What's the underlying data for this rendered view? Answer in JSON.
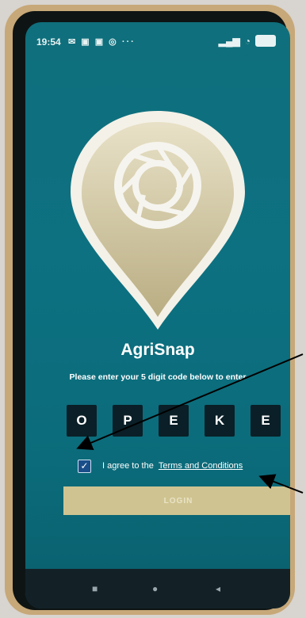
{
  "status_bar": {
    "time": "19:54",
    "left_icons": [
      "message-icon",
      "image-icon",
      "image-icon",
      "chat-icon",
      "more-icon"
    ],
    "right_icons": [
      "signal-icon",
      "wifi-icon",
      "battery-icon"
    ]
  },
  "app": {
    "name": "AgriSnap",
    "subtitle": "Please enter your 5 digit code below to enter",
    "code": [
      "O",
      "P",
      "E",
      "K",
      "E"
    ],
    "agree_text": "I agree to the",
    "terms_link": "Terms and Conditions",
    "checkbox_checked": true,
    "login_label": "LOGIN"
  },
  "nav": {
    "square": "■",
    "home": "●",
    "back": "◂"
  },
  "colors": {
    "screen_bg": "#0d7181",
    "pin_fill": "#d7d2b2",
    "code_box": "#0a1f27",
    "login_button": "#cfc491"
  }
}
